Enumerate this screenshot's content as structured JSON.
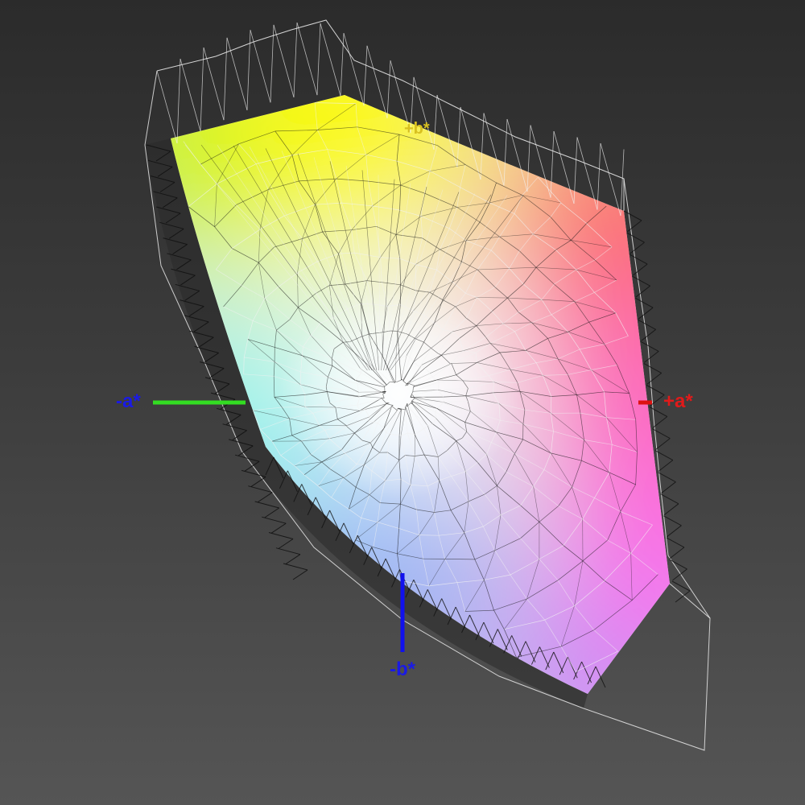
{
  "axes": {
    "neg_a": {
      "label": "-a*",
      "color": "#1a1ae6"
    },
    "pos_a": {
      "label": "+a*",
      "color": "#e01a1a"
    },
    "pos_b": {
      "label": "+b*",
      "color": "#d8c020"
    },
    "neg_b": {
      "label": "-b*",
      "color": "#1a1ae6"
    }
  },
  "axis_line_colors": {
    "neg_a": "#33dd22",
    "pos_a": "#dd1111",
    "neg_b": "#1111ee"
  },
  "corner_colors": {
    "top_left": "#a6f01c",
    "top_mid": "#fffb00",
    "top_right": "#ff5a3c",
    "left_mid": "#6ef7e6",
    "right_mid": "#ff54b6",
    "bottom_left": "#8aa6f5",
    "bottom_mid": "#b98af5",
    "bottom_right": "#ff4ff2",
    "center": "#ffffff"
  },
  "wireframe_colors": {
    "light": "#f2f2f2",
    "dark": "#111111"
  }
}
